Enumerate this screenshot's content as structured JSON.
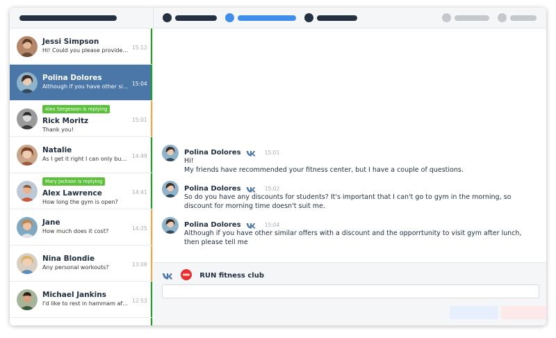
{
  "colors": {
    "accent": "#4a76a8",
    "unread_stripe": "#1ca31c",
    "pending_stripe": "#f4a742",
    "replying_badge": "#5cc13a",
    "topbar_dark": "#253141",
    "topbar_blue": "#3f8ee9",
    "topbar_gray": "#b9bec4"
  },
  "sidebar": {
    "chats": [
      {
        "name": "Jessi Simpson",
        "preview": "Hi! Could you please provide some information",
        "time": "15:12",
        "stripe": "green",
        "avatar": "avatar-jessi"
      },
      {
        "name": "Polina Dolores",
        "preview": "Although if you have other similar offers",
        "time": "15:04",
        "stripe": "green",
        "active": true,
        "avatar": "avatar-polina"
      },
      {
        "name": "Rick Moritz",
        "preview": "Thank you!",
        "time": "15:01",
        "stripe": "orange",
        "replying": "Alex Sergesson is replying",
        "avatar": "avatar-rick"
      },
      {
        "name": "Natalie",
        "preview": "As I get it right I can only buy one...",
        "time": "14:49",
        "stripe": "green",
        "avatar": "avatar-natalie"
      },
      {
        "name": "Alex Lawrence",
        "preview": "How long the gym is open?",
        "time": "14:41",
        "stripe": "green",
        "replying": "Mary Jackson is replying",
        "avatar": "avatar-alex"
      },
      {
        "name": "Jane",
        "preview": "How much does it cost?",
        "time": "14:25",
        "stripe": "orange",
        "avatar": "avatar-jane"
      },
      {
        "name": "Nina Blondie",
        "preview": "Any personal workouts?",
        "time": "13:08",
        "stripe": "orange",
        "avatar": "avatar-nina"
      },
      {
        "name": "Michael Jankins",
        "preview": "I'd like to rest in hammam after workout",
        "time": "12:53",
        "stripe": "green",
        "avatar": "avatar-michael"
      }
    ]
  },
  "messages": [
    {
      "author": "Polina Dolores",
      "time": "15:01",
      "text": "Hi!\nMy friends have recommended your fitness center, but I have a couple of questions."
    },
    {
      "author": "Polina Dolores",
      "time": "15:02",
      "text": "So do you have any discounts for students? It's important that I can't go to gym in the morning, so discount for morning time doesn't suit me."
    },
    {
      "author": "Polina Dolores",
      "time": "15:04",
      "text": "Although if you have other similar offers with a discount and the opporrtunity to visit gym after lunch, then please tell me"
    }
  ],
  "composer": {
    "club_name": "RUN fitness club",
    "network_icon": "vk-icon",
    "club_logo": "run-logo-icon"
  }
}
